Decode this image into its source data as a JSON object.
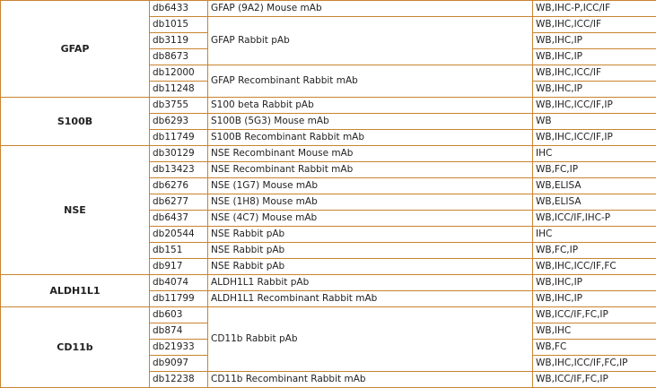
{
  "groups": [
    {
      "target": "GFAP",
      "rows": [
        {
          "cat": "db6433",
          "name": "GFAP (9A2) Mouse mAb",
          "app": "WB,IHC-P,ICC/IF"
        },
        {
          "cat": "db1015",
          "name": "GFAP Rabbit pAb",
          "app": "WB,IHC,ICC/IF"
        },
        {
          "cat": "db3119",
          "name": null,
          "app": "WB,IHC,IP"
        },
        {
          "cat": "db8673",
          "name": null,
          "app": "WB,IHC,IP"
        },
        {
          "cat": "db12000",
          "name": "GFAP Recombinant Rabbit mAb",
          "app": "WB,IHC,ICC/IF"
        },
        {
          "cat": "db11248",
          "name": null,
          "app": "WB,IHC,IP"
        }
      ]
    },
    {
      "target": "S100B",
      "rows": [
        {
          "cat": "db3755",
          "name": "S100 beta Rabbit pAb",
          "app": "WB,IHC,ICC/IF,IP"
        },
        {
          "cat": "db6293",
          "name": "S100B (5G3) Mouse mAb",
          "app": "WB"
        },
        {
          "cat": "db11749",
          "name": "S100B Recombinant Rabbit mAb",
          "app": "WB,IHC,ICC/IF,IP"
        }
      ]
    },
    {
      "target": "NSE",
      "rows": [
        {
          "cat": "db30129",
          "name": "NSE Recombinant Mouse mAb",
          "app": "IHC"
        },
        {
          "cat": "db13423",
          "name": "NSE Recombinant Rabbit mAb",
          "app": "WB,FC,IP"
        },
        {
          "cat": "db6276",
          "name": "NSE (1G7) Mouse mAb",
          "app": "WB,ELISA"
        },
        {
          "cat": "db6277",
          "name": "NSE (1H8) Mouse mAb",
          "app": "WB,ELISA"
        },
        {
          "cat": "db6437",
          "name": "NSE (4C7) Mouse mAb",
          "app": "WB,ICC/IF,IHC-P"
        },
        {
          "cat": "db20544",
          "name": "NSE Rabbit pAb",
          "app": "IHC"
        },
        {
          "cat": "db151",
          "name": "NSE Rabbit pAb",
          "app": "WB,FC,IP"
        },
        {
          "cat": "db917",
          "name": "NSE Rabbit pAb",
          "app": "WB,IHC,ICC/IF,FC"
        }
      ]
    },
    {
      "target": "ALDH1L1",
      "rows": [
        {
          "cat": "db4074",
          "name": "ALDH1L1 Rabbit pAb",
          "app": "WB,IHC,IP"
        },
        {
          "cat": "db11799",
          "name": "ALDH1L1 Recombinant Rabbit mAb",
          "app": "WB,IHC,IP"
        }
      ]
    },
    {
      "target": "CD11b",
      "rows": [
        {
          "cat": "db603",
          "name": "CD11b Rabbit pAb",
          "app": "WB,ICC/IF,FC,IP"
        },
        {
          "cat": "db874",
          "name": null,
          "app": "WB,IHC"
        },
        {
          "cat": "db21933",
          "name": null,
          "app": "WB,FC"
        },
        {
          "cat": "db9097",
          "name": null,
          "app": "WB,IHC,ICC/IF,FC,IP"
        },
        {
          "cat": "db12238",
          "name": "CD11b Recombinant Rabbit mAb",
          "app": "WB,ICC/IF,FC,IP"
        }
      ]
    }
  ]
}
